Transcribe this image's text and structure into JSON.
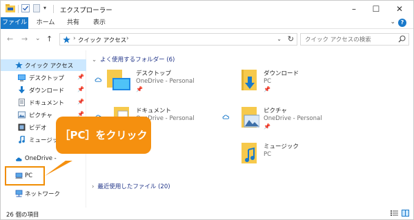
{
  "window": {
    "title": "エクスプローラー",
    "minimize": "–",
    "maximize": "☐",
    "close": "✕"
  },
  "ribbon": {
    "tabs": [
      "ファイル",
      "ホーム",
      "共有",
      "表示"
    ],
    "expand": "⌄",
    "help": "?"
  },
  "nav": {
    "back": "←",
    "forward": "→",
    "recent": "⌄",
    "up": "↑",
    "address": "クイック アクセス",
    "search_placeholder": "クイック アクセスの検索"
  },
  "sidebar": {
    "quick_access": "クイック アクセス",
    "pinned": [
      {
        "label": "デスクトップ",
        "icon": "desktop-icon"
      },
      {
        "label": "ダウンロード",
        "icon": "download-icon"
      },
      {
        "label": "ドキュメント",
        "icon": "document-icon"
      },
      {
        "label": "ピクチャ",
        "icon": "pictures-icon"
      },
      {
        "label": "ビデオ",
        "icon": "video-icon"
      },
      {
        "label": "ミュージック",
        "icon": "music-icon"
      }
    ],
    "onedrive": "OneDrive -",
    "pc": "PC",
    "network": "ネットワーク"
  },
  "content": {
    "frequent_header": "よく使用するフォルダー (6)",
    "recent_header": "最近使用したファイル (20)",
    "folders": [
      {
        "name": "デスクトップ",
        "sub": "OneDrive - Personal",
        "cloud": true,
        "pinned": true,
        "icon": "desktop-folder-icon"
      },
      {
        "name": "ダウンロード",
        "sub": "PC",
        "cloud": false,
        "pinned": true,
        "icon": "download-folder-icon"
      },
      {
        "name": "ドキュメント",
        "sub": "OneDrive - Personal",
        "cloud": true,
        "pinned": true,
        "icon": "document-folder-icon"
      },
      {
        "name": "ピクチャ",
        "sub": "OneDrive - Personal",
        "cloud": true,
        "pinned": true,
        "icon": "pictures-folder-icon"
      },
      {
        "name": "ミュージック",
        "sub": "PC",
        "cloud": false,
        "pinned": false,
        "icon": "music-folder-icon"
      }
    ]
  },
  "status": {
    "items": "26 個の項目"
  },
  "callout": {
    "text": "［PC］をクリック"
  },
  "colors": {
    "accent": "#1979ca",
    "callout": "#f5900f",
    "selection": "#cce8ff",
    "folder": "#f6c94c"
  }
}
